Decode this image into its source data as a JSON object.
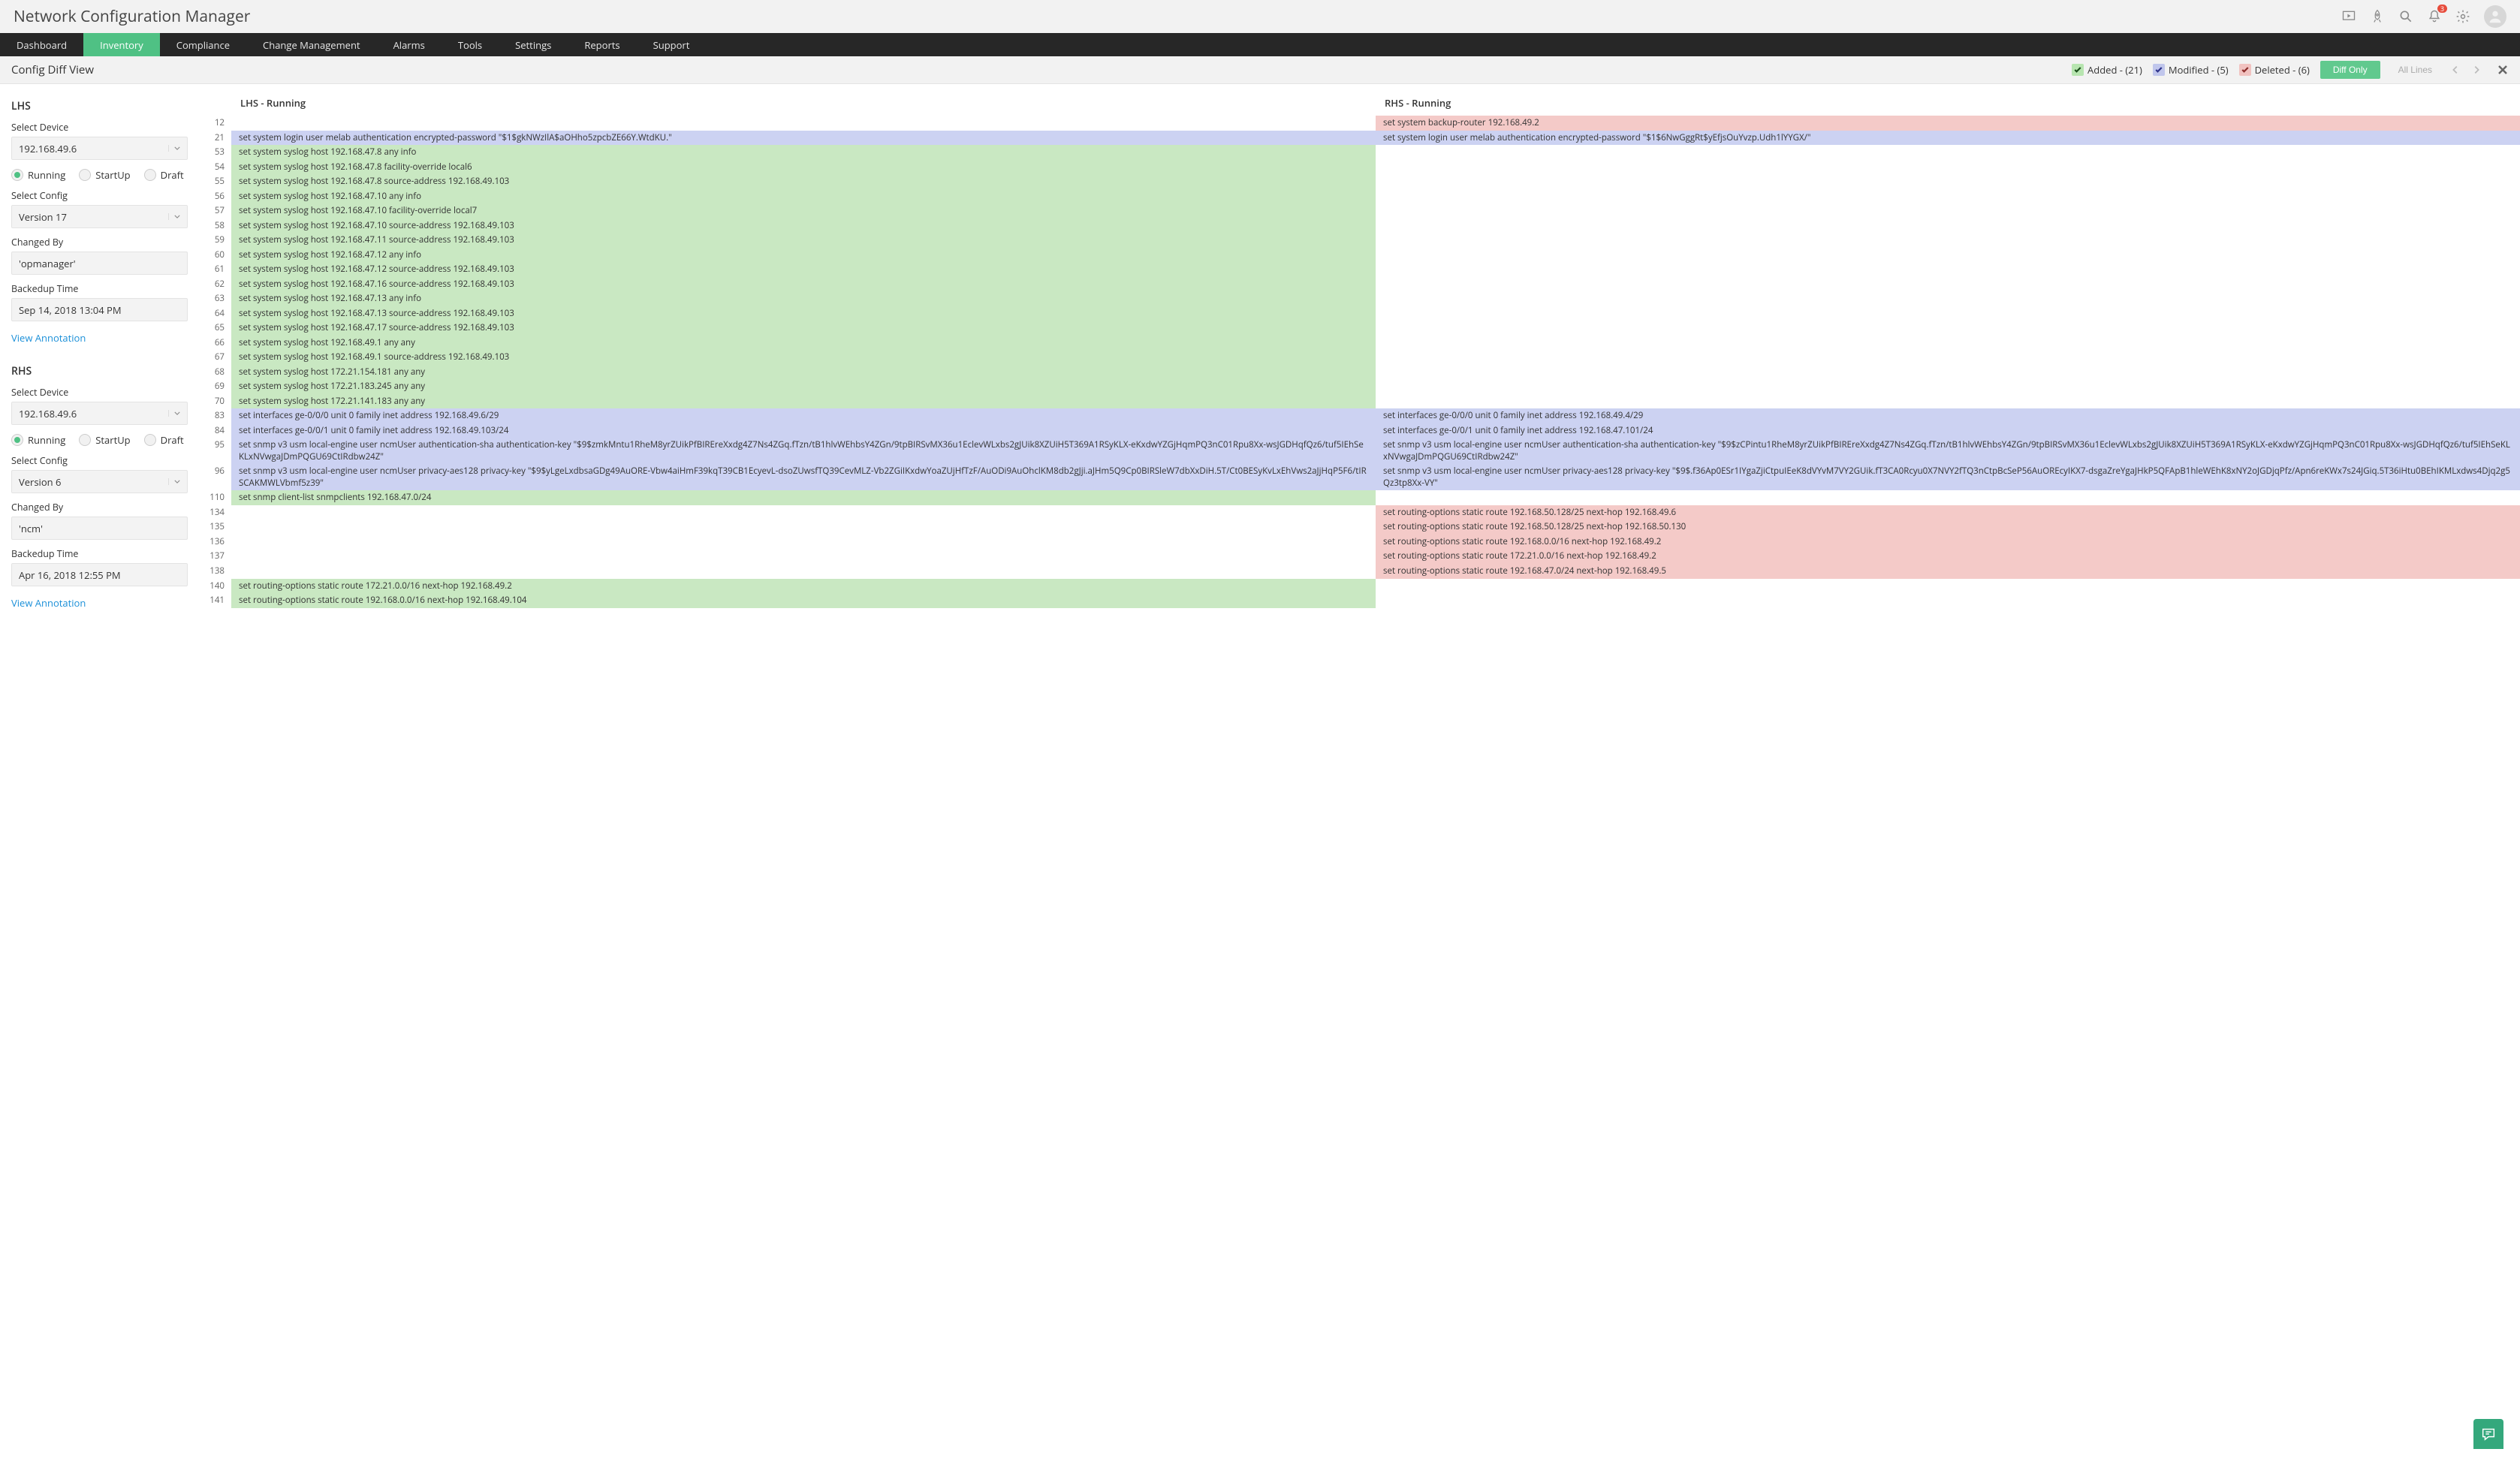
{
  "app_title": "Network Configuration Manager",
  "notif_count": "3",
  "nav": [
    "Dashboard",
    "Inventory",
    "Compliance",
    "Change Management",
    "Alarms",
    "Tools",
    "Settings",
    "Reports",
    "Support"
  ],
  "nav_active_index": 1,
  "subhead": {
    "title": "Config Diff View",
    "added_label": "Added - (21)",
    "modified_label": "Modified - (5)",
    "deleted_label": "Deleted - (6)",
    "diff_only": "Diff Only",
    "all_lines": "All Lines"
  },
  "sidebar": {
    "lhs_title": "LHS",
    "rhs_title": "RHS",
    "select_device_label": "Select Device",
    "select_config_label": "Select Config",
    "changed_by_label": "Changed By",
    "backedup_label": "Backedup Time",
    "view_annotation": "View Annotation",
    "radios": {
      "running": "Running",
      "startup": "StartUp",
      "draft": "Draft"
    },
    "lhs": {
      "device": "192.168.49.6",
      "config": "Version 17",
      "changed_by": "'opmanager'",
      "backedup": "Sep 14, 2018 13:04 PM"
    },
    "rhs": {
      "device": "192.168.49.6",
      "config": "Version 6",
      "changed_by": "'ncm'",
      "backedup": "Apr 16, 2018 12:55 PM"
    }
  },
  "diff": {
    "lhs_header": "LHS - Running",
    "rhs_header": "RHS - Running",
    "rows": [
      {
        "ln": "12",
        "lhs": "",
        "rhs": "set system backup-router 192.168.49.2",
        "lcls": "",
        "rcls": "bg-deleted"
      },
      {
        "ln": "21",
        "lhs": "set system login user melab authentication encrypted-password \"$1$gkNWzIlA$aOHho5zpcbZE66Y.WtdKU.\"",
        "rhs": "set system login user melab authentication encrypted-password \"$1$6NwGggRt$yEfjsOuYvzp.Udh1lYYGX/\"",
        "lcls": "bg-modified",
        "rcls": "bg-modified"
      },
      {
        "ln": "53",
        "lhs": "set system syslog host 192.168.47.8 any info",
        "rhs": "",
        "lcls": "bg-added",
        "rcls": ""
      },
      {
        "ln": "54",
        "lhs": "set system syslog host 192.168.47.8 facility-override local6",
        "rhs": "",
        "lcls": "bg-added",
        "rcls": ""
      },
      {
        "ln": "55",
        "lhs": "set system syslog host 192.168.47.8 source-address 192.168.49.103",
        "rhs": "",
        "lcls": "bg-added",
        "rcls": ""
      },
      {
        "ln": "56",
        "lhs": "set system syslog host 192.168.47.10 any info",
        "rhs": "",
        "lcls": "bg-added",
        "rcls": ""
      },
      {
        "ln": "57",
        "lhs": "set system syslog host 192.168.47.10 facility-override local7",
        "rhs": "",
        "lcls": "bg-added",
        "rcls": ""
      },
      {
        "ln": "58",
        "lhs": "set system syslog host 192.168.47.10 source-address 192.168.49.103",
        "rhs": "",
        "lcls": "bg-added",
        "rcls": ""
      },
      {
        "ln": "59",
        "lhs": "set system syslog host 192.168.47.11 source-address 192.168.49.103",
        "rhs": "",
        "lcls": "bg-added",
        "rcls": ""
      },
      {
        "ln": "60",
        "lhs": "set system syslog host 192.168.47.12 any info",
        "rhs": "",
        "lcls": "bg-added",
        "rcls": ""
      },
      {
        "ln": "61",
        "lhs": "set system syslog host 192.168.47.12 source-address 192.168.49.103",
        "rhs": "",
        "lcls": "bg-added",
        "rcls": ""
      },
      {
        "ln": "62",
        "lhs": "set system syslog host 192.168.47.16 source-address 192.168.49.103",
        "rhs": "",
        "lcls": "bg-added",
        "rcls": ""
      },
      {
        "ln": "63",
        "lhs": "set system syslog host 192.168.47.13 any info",
        "rhs": "",
        "lcls": "bg-added",
        "rcls": ""
      },
      {
        "ln": "64",
        "lhs": "set system syslog host 192.168.47.13 source-address 192.168.49.103",
        "rhs": "",
        "lcls": "bg-added",
        "rcls": ""
      },
      {
        "ln": "65",
        "lhs": "set system syslog host 192.168.47.17 source-address 192.168.49.103",
        "rhs": "",
        "lcls": "bg-added",
        "rcls": ""
      },
      {
        "ln": "66",
        "lhs": "set system syslog host 192.168.49.1 any any",
        "rhs": "",
        "lcls": "bg-added",
        "rcls": ""
      },
      {
        "ln": "67",
        "lhs": "set system syslog host 192.168.49.1 source-address 192.168.49.103",
        "rhs": "",
        "lcls": "bg-added",
        "rcls": ""
      },
      {
        "ln": "68",
        "lhs": "set system syslog host 172.21.154.181 any any",
        "rhs": "",
        "lcls": "bg-added",
        "rcls": ""
      },
      {
        "ln": "69",
        "lhs": "set system syslog host 172.21.183.245 any any",
        "rhs": "",
        "lcls": "bg-added",
        "rcls": ""
      },
      {
        "ln": "70",
        "lhs": "set system syslog host 172.21.141.183 any any",
        "rhs": "",
        "lcls": "bg-added",
        "rcls": ""
      },
      {
        "ln": "83",
        "lhs": "set interfaces ge-0/0/0 unit 0 family inet address 192.168.49.6/29",
        "rhs": "set interfaces ge-0/0/0 unit 0 family inet address 192.168.49.4/29",
        "lcls": "bg-modified",
        "rcls": "bg-modified"
      },
      {
        "ln": "84",
        "lhs": "set interfaces ge-0/0/1 unit 0 family inet address 192.168.49.103/24",
        "rhs": "set interfaces ge-0/0/1 unit 0 family inet address 192.168.47.101/24",
        "lcls": "bg-modified",
        "rcls": "bg-modified"
      },
      {
        "ln": "95",
        "lhs": "set snmp v3 usm local-engine user ncmUser authentication-sha authentication-key \"$9$zmkMntu1RheM8yrZUikPfBIREreXxdg4Z7Ns4ZGq.fTzn/tB1hlvWEhbsY4ZGn/9tpBIRSvMX36u1EclevWLxbs2gJUik8XZUiH5T369A1RSyKLX-eKxdwYZGjHqmPQ3nC01Rpu8Xx-wsJGDHqfQz6/tuf5IEhSeKLxNVwgaJDmPQGU69CtIRdbw24Z\"",
        "rhs": "set snmp v3 usm local-engine user ncmUser authentication-sha authentication-key \"$9$zCPintu1RheM8yrZUikPfBIREreXxdg4Z7Ns4ZGq.fTzn/tB1hlvWEhbsY4ZGn/9tpBIRSvMX36u1EclevWLxbs2gJUik8XZUiH5T369A1RSyKLX-eKxdwYZGjHqmPQ3nC01Rpu8Xx-wsJGDHqfQz6/tuf5IEhSeKLxNVwgaJDmPQGU69CtIRdbw24Z\"",
        "lcls": "bg-modified",
        "rcls": "bg-modified"
      },
      {
        "ln": "96",
        "lhs": "set snmp v3 usm local-engine user ncmUser privacy-aes128 privacy-key \"$9$yLgeLxdbsaGDg49AuORE-Vbw4aiHmF39kqT39CB1EcyevL-dsoZUwsfTQ39CevMLZ-Vb2ZGiIKxdwYoaZUjHfTzF/AuODi9AuOhclKM8db2gJji.aJHm5Q9Cp0BIRSleW7dbXxDiH.5T/Ct0BESyKvLxEhVws2aJjHqP5F6/tIRSCAKMWLVbmf5z39\"",
        "rhs": "set snmp v3 usm local-engine user ncmUser privacy-aes128 privacy-key \"$9$.f36Ap0ESr1IYgaZjiCtpuIEeK8dVYvM7VY2GUik.fT3CA0Rcyu0X7NVY2fTQ3nCtpBcSeP56AuOREcyIKX7-dsgaZreYgaJHkP5QFApB1hleWEhK8xNY2oJGDjqPfz/Apn6reKWx7s24JGiq.5T36iHtu0BEhIKMLxdws4Djq2g5Qz3tp8Xx-VY\"",
        "lcls": "bg-modified",
        "rcls": "bg-modified"
      },
      {
        "ln": "110",
        "lhs": "set snmp client-list snmpclients 192.168.47.0/24",
        "rhs": "",
        "lcls": "bg-added",
        "rcls": ""
      },
      {
        "ln": "134",
        "lhs": "",
        "rhs": "set routing-options static route 192.168.50.128/25 next-hop 192.168.49.6",
        "lcls": "",
        "rcls": "bg-deleted"
      },
      {
        "ln": "135",
        "lhs": "",
        "rhs": "set routing-options static route 192.168.50.128/25 next-hop 192.168.50.130",
        "lcls": "",
        "rcls": "bg-deleted"
      },
      {
        "ln": "136",
        "lhs": "",
        "rhs": "set routing-options static route 192.168.0.0/16 next-hop 192.168.49.2",
        "lcls": "",
        "rcls": "bg-deleted"
      },
      {
        "ln": "137",
        "lhs": "",
        "rhs": "set routing-options static route 172.21.0.0/16 next-hop 192.168.49.2",
        "lcls": "",
        "rcls": "bg-deleted"
      },
      {
        "ln": "138",
        "lhs": "",
        "rhs": "set routing-options static route 192.168.47.0/24 next-hop 192.168.49.5",
        "lcls": "",
        "rcls": "bg-deleted"
      },
      {
        "ln": "140",
        "lhs": "set routing-options static route 172.21.0.0/16 next-hop 192.168.49.2",
        "rhs": "",
        "lcls": "bg-added",
        "rcls": ""
      },
      {
        "ln": "141",
        "lhs": "set routing-options static route 192.168.0.0/16 next-hop 192.168.49.104",
        "rhs": "",
        "lcls": "bg-added",
        "rcls": ""
      }
    ]
  }
}
